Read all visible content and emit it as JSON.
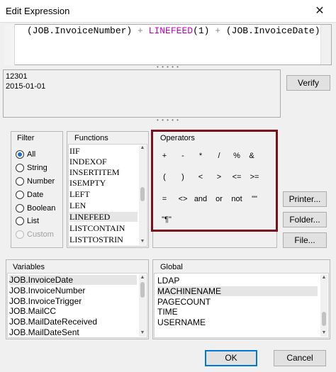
{
  "window": {
    "title": "Edit Expression",
    "close_glyph": "✕"
  },
  "expression": {
    "part1": "(JOB.InvoiceNumber)",
    "plus1": " + ",
    "fn": "LINEFEED",
    "arg": "(1)",
    "plus2": " + ",
    "part3": "(JOB.InvoiceDate)"
  },
  "result": {
    "line1": "12301",
    "line2": "2015-01-01"
  },
  "buttons": {
    "verify": "Verify",
    "printer": "Printer...",
    "folder": "Folder...",
    "file": "File...",
    "ok": "OK",
    "cancel": "Cancel"
  },
  "filter": {
    "header": "Filter",
    "options": [
      "All",
      "String",
      "Number",
      "Date",
      "Boolean",
      "List",
      "Custom"
    ],
    "selected": "All",
    "disabled": [
      "Custom"
    ]
  },
  "functions": {
    "header": "Functions",
    "items": [
      "IIF",
      "INDEXOF",
      "INSERTITEM",
      "ISEMPTY",
      "LEFT",
      "LEN",
      "LINEFEED",
      "LISTCONTAIN",
      "LISTTOSTRIN"
    ],
    "selected": "LINEFEED"
  },
  "operators": {
    "header": "Operators",
    "row1": [
      "+",
      "-",
      "*",
      "/",
      "%",
      "&"
    ],
    "row2": [
      "(",
      ")",
      "<",
      ">",
      "<=",
      ">="
    ],
    "row3": [
      "=",
      "<>",
      "and",
      "or",
      "not",
      "\"\""
    ],
    "row4": [
      "\"¶\""
    ]
  },
  "variables": {
    "header": "Variables",
    "items": [
      "JOB.InvoiceDate",
      "JOB.InvoiceNumber",
      "JOB.InvoiceTrigger",
      "JOB.MailCC",
      "JOB.MailDateReceived",
      "JOB.MailDateSent"
    ],
    "selected": "JOB.InvoiceDate"
  },
  "global": {
    "header": "Global",
    "items": [
      "LDAP",
      "MACHINENAME",
      "PAGECOUNT",
      "TIME",
      "USERNAME"
    ],
    "selected": "MACHINENAME"
  },
  "colors": {
    "highlight": "#7d0f1c",
    "accent": "#0078d7",
    "function_token": "#c000c0"
  }
}
